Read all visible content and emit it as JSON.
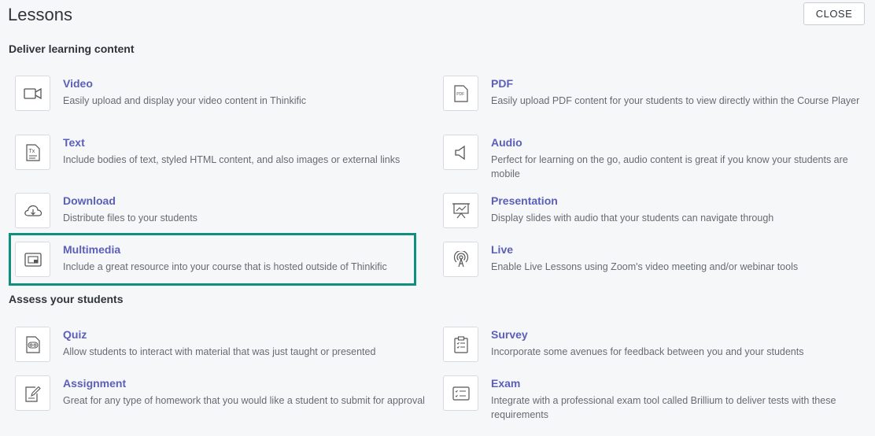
{
  "header": {
    "title": "Lessons",
    "close_label": "CLOSE"
  },
  "sections": [
    {
      "label": "Deliver learning content"
    },
    {
      "label": "Assess your students"
    }
  ],
  "items": [
    {
      "title": "Video",
      "description": "Easily upload and display your video content in Thinkific",
      "icon": "video-icon"
    },
    {
      "title": "PDF",
      "description": "Easily upload PDF content for your students to view directly within the Course Player",
      "icon": "pdf-icon"
    },
    {
      "title": "Text",
      "description": "Include bodies of text, styled HTML content, and also images or external links",
      "icon": "text-icon"
    },
    {
      "title": "Audio",
      "description": "Perfect for learning on the go, audio content is great if you know your students are mobile",
      "icon": "audio-icon"
    },
    {
      "title": "Download",
      "description": "Distribute files to your students",
      "icon": "download-icon"
    },
    {
      "title": "Presentation",
      "description": "Display slides with audio that your students can navigate through",
      "icon": "presentation-icon"
    },
    {
      "title": "Multimedia",
      "description": "Include a great resource into your course that is hosted outside of Thinkific",
      "icon": "multimedia-icon"
    },
    {
      "title": "Live",
      "description": "Enable Live Lessons using Zoom's video meeting and/or webinar tools",
      "icon": "live-icon"
    },
    {
      "title": "Quiz",
      "description": "Allow students to interact with material that was just taught or presented",
      "icon": "quiz-icon"
    },
    {
      "title": "Survey",
      "description": "Incorporate some avenues for feedback between you and your students",
      "icon": "survey-icon"
    },
    {
      "title": "Assignment",
      "description": "Great for any type of homework that you would like a student to submit for approval",
      "icon": "assignment-icon"
    },
    {
      "title": "Exam",
      "description": "Integrate with a professional exam tool called Brillium to deliver tests with these requirements",
      "icon": "exam-icon"
    }
  ],
  "colors": {
    "accent_title": "#5b5fb8",
    "highlight_border": "#0f8f7f",
    "background": "#f6f7f9"
  }
}
